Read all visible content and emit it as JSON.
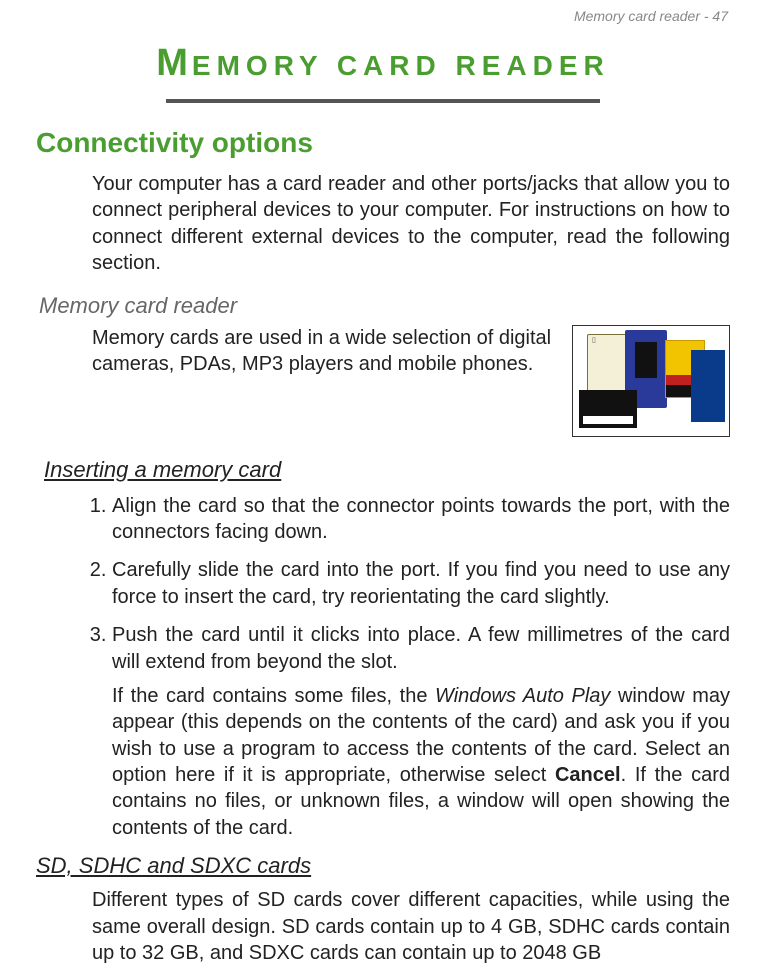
{
  "header": {
    "running_head": "Memory card reader - 47"
  },
  "chapter": {
    "title_first": "M",
    "title_rest": "EMORY CARD READER"
  },
  "section": {
    "title": "Connectivity options",
    "intro": "Your computer has a card reader and other ports/jacks that allow you to connect peripheral devices to your computer. For instructions on how to connect different external devices to the computer, read the following section."
  },
  "subsection1": {
    "heading": "Memory card reader",
    "text": "Memory cards are used in a wide selection of digital cameras, PDAs, MP3 players and mobile phones.",
    "figure_alt": "memory-cards-illustration"
  },
  "subsection2": {
    "heading": "Inserting a memory card",
    "steps": [
      "Align the card so that the connector points towards the port, with the connectors facing down.",
      "Carefully slide the card into the port. If you find you need to use any force to insert the card, try reorientating the card slightly.",
      "Push the card until it clicks into place. A few millimetres of the card will extend from beyond the slot."
    ],
    "para_before_em": "If the card contains some files, the ",
    "para_em": "Windows Auto Play",
    "para_mid": " window may appear (this depends on the contents of the card) and ask you if you wish to use a program to access the contents of the card. Select an option here if it is appropriate, otherwise select ",
    "para_bold": "Cancel",
    "para_after": ". If the card contains no files, or unknown files, a window will open showing the contents of the card."
  },
  "subsection3": {
    "heading": "SD, SDHC and SDXC cards",
    "text": "Different types of SD cards cover different capacities, while using the same overall design. SD cards contain up to 4 GB, SDHC cards contain up to 32 GB, and SDXC cards can contain up to 2048 GB"
  }
}
